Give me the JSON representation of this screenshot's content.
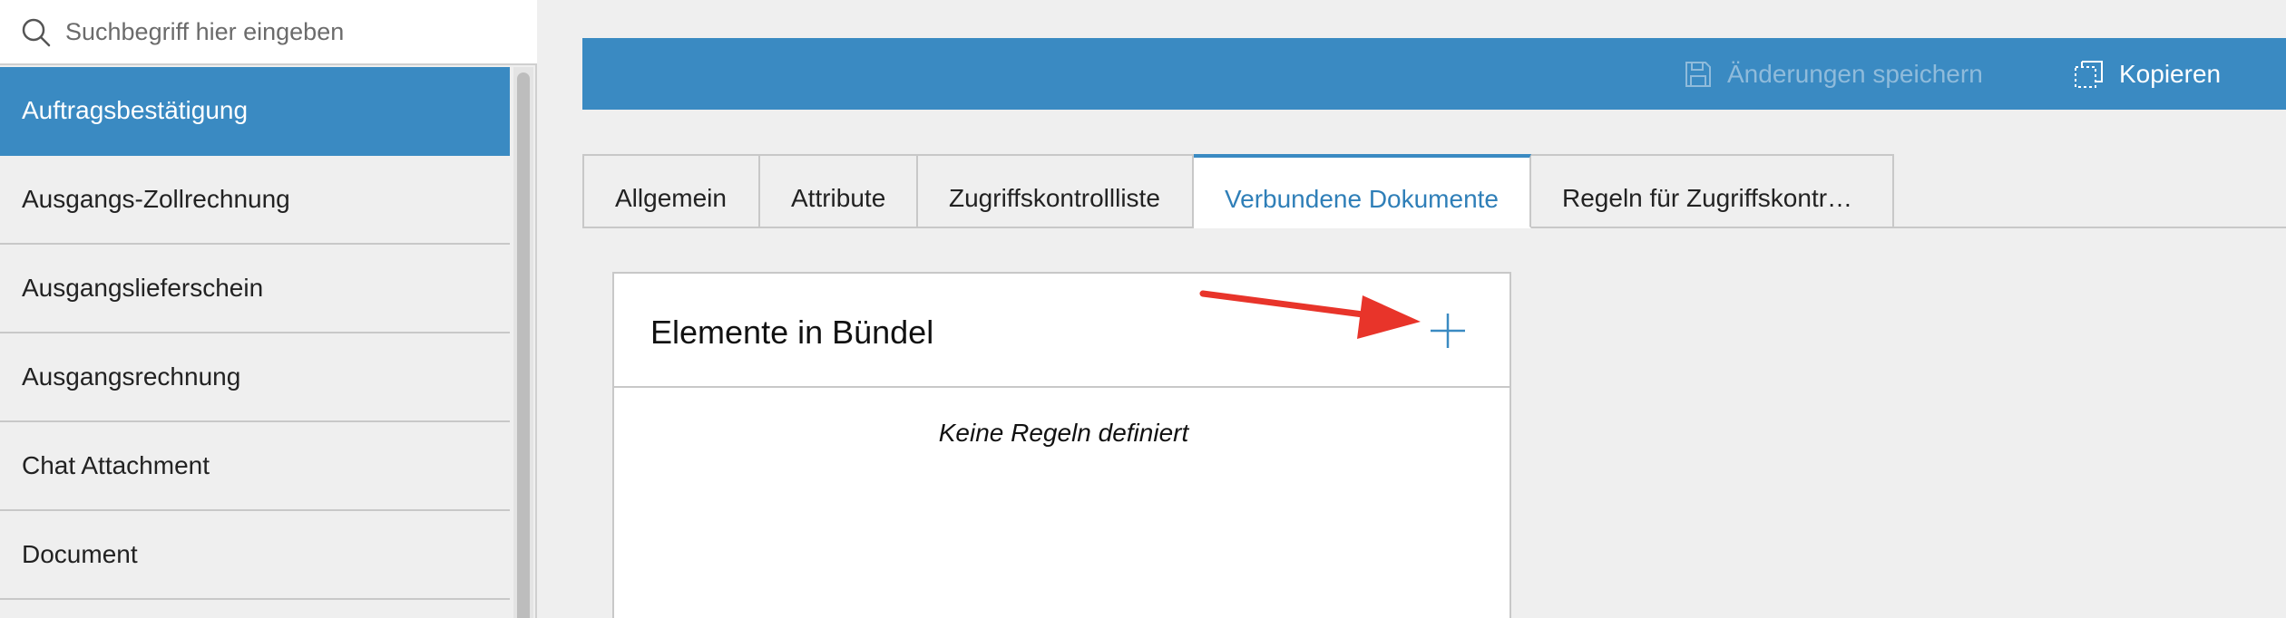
{
  "search": {
    "placeholder": "Suchbegriff hier eingeben",
    "value": ""
  },
  "sidebar": {
    "items": [
      {
        "label": "Auftragsbestätigung",
        "active": true
      },
      {
        "label": "Ausgangs-Zollrechnung",
        "active": false
      },
      {
        "label": "Ausgangslieferschein",
        "active": false
      },
      {
        "label": "Ausgangsrechnung",
        "active": false
      },
      {
        "label": "Chat Attachment",
        "active": false
      },
      {
        "label": "Document",
        "active": false
      }
    ]
  },
  "toolbar": {
    "save_label": "Änderungen speichern",
    "copy_label": "Kopieren",
    "color": "#3a8ac2"
  },
  "tabs": [
    {
      "label": "Allgemein"
    },
    {
      "label": "Attribute"
    },
    {
      "label": "Zugriffskontrollliste"
    },
    {
      "label": "Verbundene Dokumente",
      "active": true
    },
    {
      "label": "Regeln für Zugriffskontr…"
    }
  ],
  "panel": {
    "title": "Elemente in Bündel",
    "empty_text": "Keine Regeln definiert",
    "add_icon": "plus-icon"
  },
  "annotation": {
    "color": "#e8342a",
    "icon": "red-arrow"
  }
}
